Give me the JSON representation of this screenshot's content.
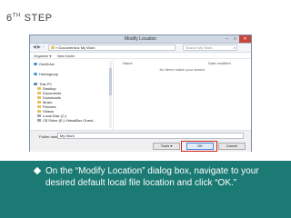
{
  "slide": {
    "title_main": "6",
    "title_sup": "TH",
    "title_rest": " STEP"
  },
  "dialog": {
    "title": "Modify Location",
    "window_buttons": {
      "minimize": "–",
      "maximize": "□",
      "close": "✕"
    },
    "address": {
      "back": "◀",
      "forward": "▶",
      "up": "↑",
      "breadcrumb": "« Documents ▸ My Work",
      "search_placeholder": "Search My Work"
    },
    "toolbar": {
      "organize": "Organize ▾",
      "new_folder": "New folder"
    },
    "nav_items": [
      {
        "label": "OneDrive",
        "icon": "cloud-icon"
      },
      {
        "label": "Homegroup",
        "icon": "homegroup-icon"
      },
      {
        "label": "This PC",
        "icon": "computer-icon"
      },
      {
        "label": "Desktop",
        "icon": "folder-icon"
      },
      {
        "label": "Documents",
        "icon": "folder-icon"
      },
      {
        "label": "Downloads",
        "icon": "folder-icon"
      },
      {
        "label": "Music",
        "icon": "folder-icon"
      },
      {
        "label": "Pictures",
        "icon": "folder-icon"
      },
      {
        "label": "Videos",
        "icon": "folder-icon"
      },
      {
        "label": "Local Disk (C:)",
        "icon": "drive-icon"
      },
      {
        "label": "C$ Shine (E:) VirtualBox Guest...",
        "icon": "drive-icon"
      }
    ],
    "columns": {
      "name": "Name",
      "date_modified": "Date modified"
    },
    "empty_message": "No items match your search.",
    "folder_label": "Folder name:",
    "folder_value": "My Work",
    "buttons": {
      "tools": "Tools ▾",
      "ok": "OK",
      "cancel": "Cancel"
    },
    "highlight_color": "#d1261d"
  },
  "caption": {
    "text": "On the “Modify Location” dialog box, navigate to your desired default local file location and click “OK.”",
    "band_color": "#1b7a74"
  }
}
